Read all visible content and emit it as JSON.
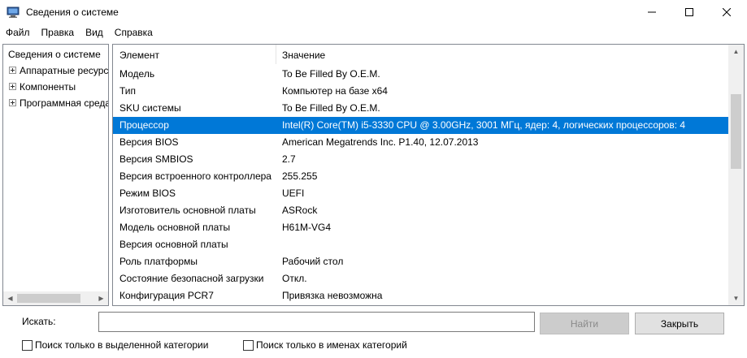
{
  "window": {
    "title": "Сведения о системе",
    "minimize_symbol": "—",
    "maximize_symbol": "☐",
    "close_symbol": "✕"
  },
  "menu": [
    "Файл",
    "Правка",
    "Вид",
    "Справка"
  ],
  "tree": {
    "root": "Сведения о системе",
    "nodes": [
      "Аппаратные ресурсы",
      "Компоненты",
      "Программная среда"
    ]
  },
  "list": {
    "headers": {
      "element": "Элемент",
      "value": "Значение"
    },
    "rows": [
      {
        "element": "Модель",
        "value": "To Be Filled By O.E.M."
      },
      {
        "element": "Тип",
        "value": "Компьютер на базе x64"
      },
      {
        "element": "SKU системы",
        "value": "To Be Filled By O.E.M."
      },
      {
        "element": "Процессор",
        "value": "Intel(R) Core(TM) i5-3330 CPU @ 3.00GHz, 3001 МГц, ядер: 4, логических процессоров: 4",
        "selected": true
      },
      {
        "element": "Версия BIOS",
        "value": "American Megatrends Inc. P1.40, 12.07.2013"
      },
      {
        "element": "Версия SMBIOS",
        "value": "2.7"
      },
      {
        "element": "Версия встроенного контроллера",
        "value": "255.255"
      },
      {
        "element": "Режим BIOS",
        "value": "UEFI"
      },
      {
        "element": "Изготовитель основной платы",
        "value": "ASRock"
      },
      {
        "element": "Модель основной платы",
        "value": "H61M-VG4"
      },
      {
        "element": "Версия основной платы",
        "value": ""
      },
      {
        "element": "Роль платформы",
        "value": "Рабочий стол"
      },
      {
        "element": "Состояние безопасной загрузки",
        "value": "Откл."
      },
      {
        "element": "Конфигурация PCR7",
        "value": "Привязка невозможна"
      }
    ]
  },
  "search": {
    "label": "Искать:",
    "value": "",
    "find_button": "Найти",
    "close_button": "Закрыть",
    "only_selected_category": "Поиск только в выделенной категории",
    "only_category_names": "Поиск только в именах категорий"
  },
  "colors": {
    "selection": "#0078d7"
  }
}
